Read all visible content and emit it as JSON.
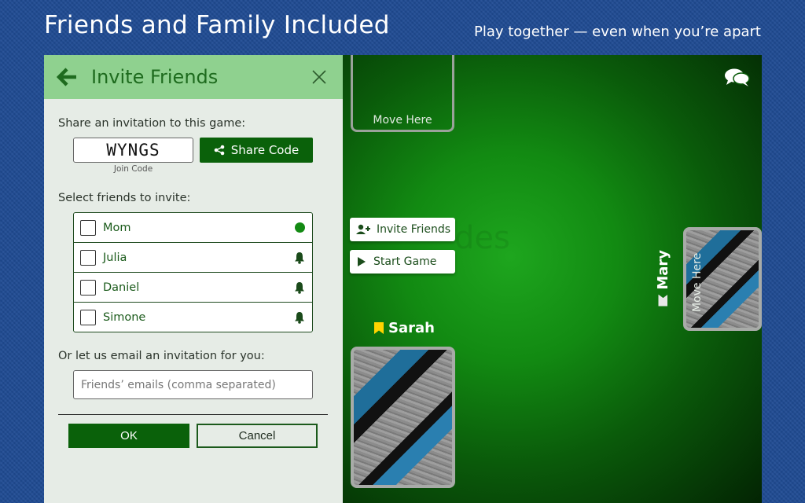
{
  "promo": {
    "title": "Friends and Family Included",
    "subtitle": "Play together — even when you’re apart"
  },
  "panel": {
    "title": "Invite Friends",
    "share_label": "Share an invitation to this game:",
    "join_code": "WYNGS",
    "join_code_caption": "Join Code",
    "share_button": "Share Code",
    "select_label": "Select friends to invite:",
    "friends": [
      {
        "name": "Mom",
        "status_icon": "online-dot-icon"
      },
      {
        "name": "Julia",
        "status_icon": "bell-icon"
      },
      {
        "name": "Daniel",
        "status_icon": "bell-icon"
      },
      {
        "name": "Simone",
        "status_icon": "bell-icon"
      }
    ],
    "email_label": "Or let us email an invitation for you:",
    "email_placeholder": "Friends’ emails (comma separated)",
    "ok_button": "OK",
    "cancel_button": "Cancel"
  },
  "table": {
    "slot_top_label": "Move Here",
    "slot_right_label": "Move Here",
    "invite_button": "Invite Friends",
    "start_button": "Start Game",
    "player_bottom": "Sarah",
    "player_right": "Mary",
    "faint_text": "des"
  },
  "colors": {
    "accent": "#0a610a",
    "header": "#8fd18f",
    "background": "#1f4b93",
    "panel_bg": "#e6ece6"
  }
}
